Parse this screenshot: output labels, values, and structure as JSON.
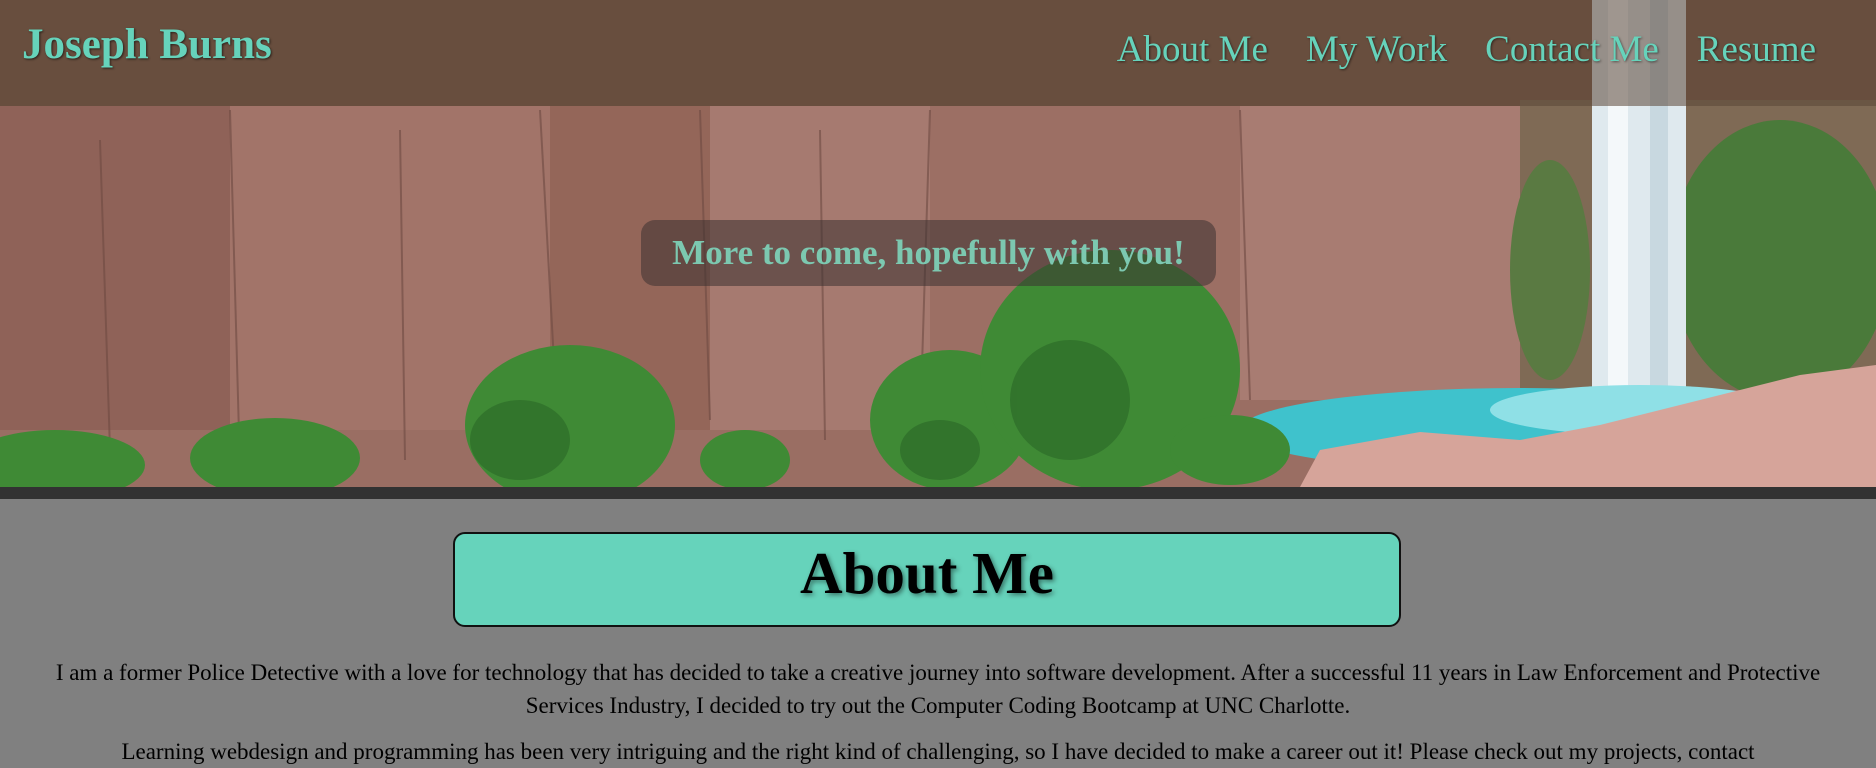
{
  "header": {
    "brand": "Joseph Burns",
    "nav": [
      {
        "label": "About Me"
      },
      {
        "label": "My Work"
      },
      {
        "label": "Contact Me"
      },
      {
        "label": "Resume"
      }
    ]
  },
  "hero": {
    "tagline": "More to come, hopefully with you!"
  },
  "about": {
    "heading": "About Me",
    "paragraphs": [
      "I am a former Police Detective with a love for technology that has decided to take a creative journey into software development. After a successful 11 years in Law Enforcement and Protective Services Industry, I decided to try out the Computer Coding Bootcamp at UNC Charlotte.",
      "Learning webdesign and programming has been very intriguing and the right kind of challenging, so I have decided to make a career out it! Please check out my projects, contact"
    ]
  },
  "colors": {
    "accent": "#66d3bb",
    "page_background": "#808080",
    "divider": "#323232"
  }
}
